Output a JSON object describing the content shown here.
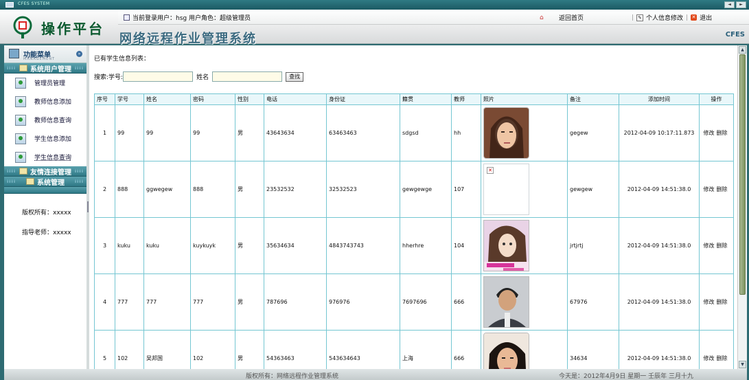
{
  "window": {
    "title": "CFES SYSTEM",
    "btn_min": "◄",
    "btn_max": "►"
  },
  "header": {
    "logo_text": "操作平台",
    "system_name": "网络远程作业管理系统",
    "user_info": "当前登录用户：hsg   用户角色：超级管理员",
    "home_link": "返回首页",
    "edit_profile": "个人信息修改",
    "logout": "退出",
    "brand": "CFES",
    "sep": "|"
  },
  "sidebar": {
    "menu_title": "功能菜单",
    "menu_subtitle": "MANAGEMENT",
    "groups": [
      {
        "label": "系统用户管理"
      },
      {
        "label": "友情连接管理"
      },
      {
        "label": "系统管理"
      }
    ],
    "items": [
      {
        "label": "管理员管理"
      },
      {
        "label": "教师信息添加"
      },
      {
        "label": "教师信息查询"
      },
      {
        "label": "学生信息添加"
      },
      {
        "label": "学生信息查询"
      }
    ],
    "copyright": "版权所有：xxxxx",
    "teacher": "指导老师：xxxxx"
  },
  "main": {
    "caption": "已有学生信息列表：",
    "search": {
      "label_id": "搜索:学号:",
      "label_name": "姓名",
      "id_value": "",
      "name_value": "",
      "button": "查找"
    },
    "columns": [
      "序号",
      "学号",
      "姓名",
      "密码",
      "性别",
      "电话",
      "身份证",
      "籍贯",
      "教师",
      "照片",
      "备注",
      "添加时间",
      "操作"
    ],
    "rows": [
      {
        "seq": "1",
        "sid": "99",
        "name": "99",
        "pwd": "99",
        "sex": "男",
        "phone": "43643634",
        "idcard": "63463463",
        "origin": "sdgsd",
        "teacher": "hh",
        "photo": "photo-woman-1",
        "remark": "gegew",
        "time": "2012-04-09 10:17:11.873",
        "edit": "修改",
        "del": "删除"
      },
      {
        "seq": "2",
        "sid": "888",
        "name": "ggwegew",
        "pwd": "888",
        "sex": "男",
        "phone": "23532532",
        "idcard": "32532523",
        "origin": "gewgewge",
        "teacher": "107",
        "photo": "broken-image",
        "remark": "gewgew",
        "time": "2012-04-09 14:51:38.0",
        "edit": "修改",
        "del": "删除"
      },
      {
        "seq": "3",
        "sid": "kuku",
        "name": "kuku",
        "pwd": "kuykuyk",
        "sex": "男",
        "phone": "35634634",
        "idcard": "4843743743",
        "origin": "hherhre",
        "teacher": "104",
        "photo": "photo-anime",
        "remark": "jrtjrtj",
        "time": "2012-04-09 14:51:38.0",
        "edit": "修改",
        "del": "删除"
      },
      {
        "seq": "4",
        "sid": "777",
        "name": "777",
        "pwd": "777",
        "sex": "男",
        "phone": "787696",
        "idcard": "976976",
        "origin": "7697696",
        "teacher": "666",
        "photo": "photo-man",
        "remark": "67976",
        "time": "2012-04-09 14:51:38.0",
        "edit": "修改",
        "del": "删除"
      },
      {
        "seq": "5",
        "sid": "102",
        "name": "吴邦国",
        "pwd": "102",
        "sex": "男",
        "phone": "54363463",
        "idcard": "543634643",
        "origin": "上海",
        "teacher": "666",
        "photo": "photo-woman-2",
        "remark": "34634",
        "time": "2012-04-09 14:51:38.0",
        "edit": "修改",
        "del": "删除"
      }
    ]
  },
  "footer": {
    "left": "版权所有：网络远程作业管理系统",
    "right": "今天是：2012年4月9日 星期一 壬辰年 三月十九"
  }
}
